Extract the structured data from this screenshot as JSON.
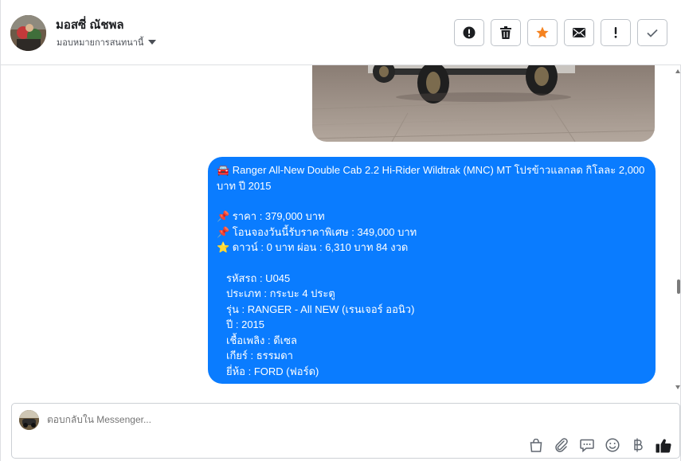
{
  "header": {
    "contact_name": "มอสซี่ ณัชพล",
    "assign_label": "มอบหมายการสนทนานี้",
    "actions": [
      {
        "icon": "alert-circle-icon"
      },
      {
        "icon": "trash-icon"
      },
      {
        "icon": "star-icon",
        "color": "#f5821f"
      },
      {
        "icon": "mail-icon"
      },
      {
        "icon": "exclamation-icon"
      },
      {
        "icon": "check-icon"
      }
    ]
  },
  "message": {
    "lines": [
      "🚘 Ranger All-New Double Cab 2.2 Hi-Rider Wildtrak (MNC) MT โปรข้าวแลกลด กิโลละ 2,000 บาท ปี 2015",
      "📌 ราคา : 379,000 บาท",
      "📌 โอนจองวันนี้รับราคาพิเศษ : 349,000 บาท",
      "⭐ ดาวน์ : 0 บาท ผ่อน : 6,310 บาท 84 งวด",
      "รหัสรถ : U045",
      "ประเภท : กระบะ 4 ประตู",
      "รุ่น : RANGER - All NEW (เรนเจอร์ ออนิว)",
      "ปี : 2015",
      "เชื้อเพลิง : ดีเซล",
      "เกียร์ : ธรรมดา",
      "ยี่ห้อ : FORD (ฟอร์ด)"
    ]
  },
  "composer": {
    "placeholder": "ตอบกลับใน Messenger...",
    "tools": [
      "bag-icon",
      "paperclip-icon",
      "speech-bubble-icon",
      "smiley-icon",
      "baht-icon",
      "thumbs-up-icon"
    ]
  },
  "colors": {
    "bubble": "#0a7cff",
    "star": "#f5821f",
    "thumb": "#1c1e21"
  }
}
